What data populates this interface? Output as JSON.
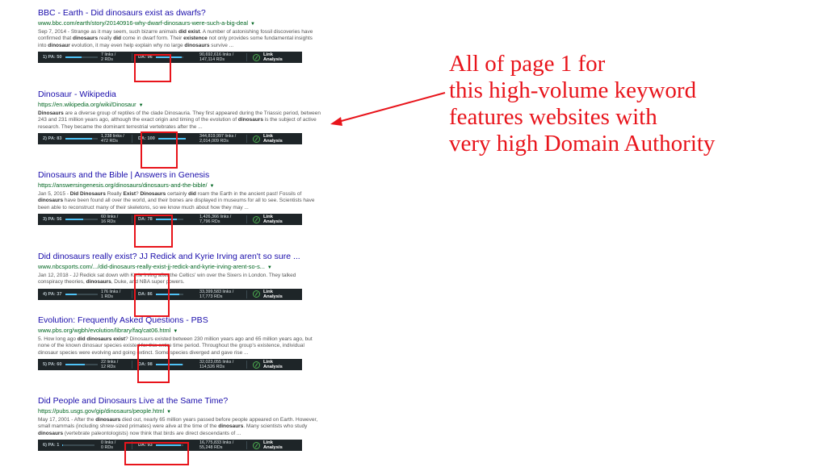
{
  "results": [
    {
      "title": "BBC - Earth - Did dinosaurs exist as dwarfs?",
      "url": "www.bbc.com/earth/story/20140916-why-dwarf-dinosaurs-were-such-a-big-deal",
      "snippet_html": "Sep 7, 2014 - Strange as it may seem, such bizarre animals <b>did exist</b>. A number of astonishing fossil discoveries have confirmed that <b>dinosaurs</b> really <b>did</b> come in dwarf form. Their <b>existence</b> not only provides some fundamental insights into <b>dinosaur</b> evolution, it may even help explain why no large <b>dinosaurs</b> survive ...",
      "moz": {
        "pa_label": "1) PA: 50",
        "pa_value": 50,
        "links": "7 links /",
        "rds": "2 RDs",
        "da_label": "DA: 96",
        "da_value": 96,
        "domain_links": "90,692,616 links /",
        "domain_rds": "147,114 RDs",
        "la_line1": "Link",
        "la_line2": "Analysis"
      }
    },
    {
      "title": "Dinosaur - Wikipedia",
      "url": "https://en.wikipedia.org/wiki/Dinosaur",
      "snippet_html": "<b>Dinosaurs</b> are a diverse group of reptiles of the clade Dinosauria. They first appeared during the Triassic period, between 243 and 231 million years ago, although the exact origin and timing of the evolution of <b>dinosaurs</b> is the subject of active research. They became the dominant terrestrial vertebrates after the ...",
      "moz": {
        "pa_label": "2) PA: 83",
        "pa_value": 83,
        "links": "1,238 links /",
        "rds": "472 RDs",
        "da_label": "DA: 100",
        "da_value": 100,
        "domain_links": "344,819,997 links /",
        "domain_rds": "2,014,009 RDs",
        "la_line1": "Link",
        "la_line2": "Analysis"
      }
    },
    {
      "title": "Dinosaurs and the Bible | Answers in Genesis",
      "url": "https://answersingenesis.org/dinosaurs/dinosaurs-and-the-bible/",
      "snippet_html": "Jan 5, 2015 - <b>Did Dinosaurs</b> Really <b>Exist</b>? <b>Dinosaurs</b> certainly <b>did</b> roam the Earth in the ancient past! Fossils of <b>dinosaurs</b> have been found all over the world, and their bones are displayed in museums for all to see. Scientists have been able to reconstruct many of their skeletons, so we know much about how they may ...",
      "moz": {
        "pa_label": "3) PA: 56",
        "pa_value": 56,
        "links": "60 links /",
        "rds": "16 RDs",
        "da_label": "DA: 78",
        "da_value": 78,
        "domain_links": "1,426,366 links /",
        "domain_rds": "7,796 RDs",
        "la_line1": "Link",
        "la_line2": "Analysis"
      }
    },
    {
      "title": "Did dinosaurs really exist? JJ Redick and Kyrie Irving aren't so sure ...",
      "url": "www.nbcsports.com/.../did-dinosaurs-really-exist-jj-redick-and-kyrie-irving-arent-so-s...",
      "snippet_html": "Jan 12, 2018 - JJ Redick sat down with Kyrie Irving after the Celtics' win over the Sixers in London. They talked conspiracy theories, <b>dinosaurs</b>, Duke, and NBA super powers.",
      "moz": {
        "pa_label": "4) PA: 37",
        "pa_value": 37,
        "links": "176 links /",
        "rds": "1 RDs",
        "da_label": "DA: 86",
        "da_value": 86,
        "domain_links": "33,399,583 links /",
        "domain_rds": "17,773 RDs",
        "la_line1": "Link",
        "la_line2": "Analysis"
      }
    },
    {
      "title": "Evolution: Frequently Asked Questions - PBS",
      "url": "www.pbs.org/wgbh/evolution/library/faq/cat06.html",
      "snippet_html": "5. How long ago <b>did dinosaurs exist</b>? Dinosaurs existed between 230 million years ago and 65 million years ago, but none of the known dinosaur species existed for this entire time period. Throughout the group's existence, individual dinosaur species were evolving and going extinct. Some species diverged and gave rise ...",
      "moz": {
        "pa_label": "5) PA: 60",
        "pa_value": 60,
        "links": "22 links /",
        "rds": "12 RDs",
        "da_label": "DA: 98",
        "da_value": 98,
        "domain_links": "32,023,055 links /",
        "domain_rds": "114,526 RDs",
        "la_line1": "Link",
        "la_line2": "Analysis"
      }
    },
    {
      "title": "Did People and Dinosaurs Live at the Same Time?",
      "url": "https://pubs.usgs.gov/gip/dinosaurs/people.html",
      "snippet_html": "May 17, 2001 - After the <b>dinosaurs</b> died out, nearly 65 million years passed before people appeared on Earth. However, small mammals (including shrew-sized primates) were alive at the time of the <b>dinosaurs</b>. Many scientists who study <b>dinosaurs</b> (vertebrate paleontologists) now think that birds are direct descendants of ...",
      "moz": {
        "pa_label": "6) PA: 1",
        "pa_value": 1,
        "links": "0 links /",
        "rds": "0 RDs",
        "da_label": "DA: 93",
        "da_value": 93,
        "domain_links": "16,775,833 links /",
        "domain_rds": "55,248 RDs",
        "la_line1": "Link",
        "la_line2": "Analysis"
      }
    }
  ],
  "callout": {
    "lines": [
      "All of page 1 for",
      "this high-volume keyword",
      "features websites with",
      "very high Domain Authority"
    ],
    "color": "#e8141b"
  },
  "colors": {
    "link": "#1a0dab",
    "url": "#006621",
    "mozbar": "#1e2528",
    "highlight": "#e8141b"
  }
}
